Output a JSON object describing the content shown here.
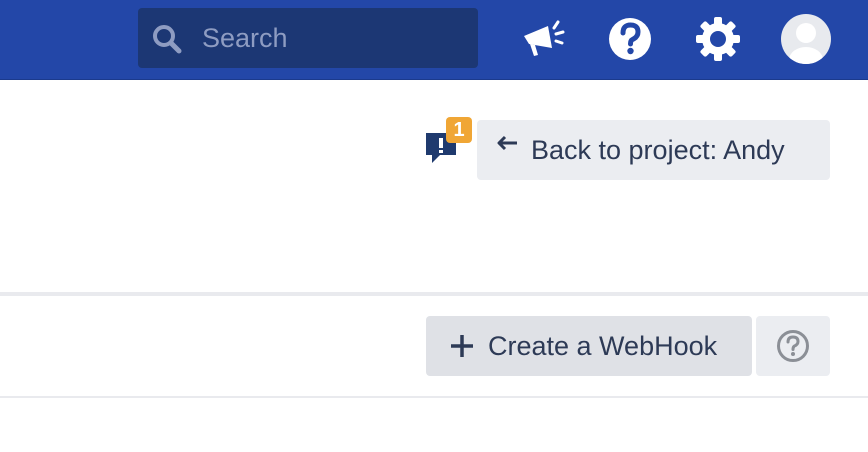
{
  "header": {
    "search": {
      "placeholder": "Search",
      "icon": "search-icon"
    },
    "icons": [
      "megaphone-icon",
      "help-icon",
      "gear-icon",
      "avatar"
    ],
    "colors": {
      "bar": "#2347a8",
      "search_bg": "#1c3774"
    }
  },
  "feedback": {
    "icon": "feedback-icon",
    "badge_count": "1",
    "badge_color": "#f0a635"
  },
  "back_button": {
    "icon": "back-arrow-icon",
    "label": "Back to project: Andy"
  },
  "webhooks": {
    "create_button": {
      "icon": "plus-icon",
      "label": "Create a WebHook"
    },
    "help_button": {
      "icon": "help-circle-icon"
    }
  }
}
